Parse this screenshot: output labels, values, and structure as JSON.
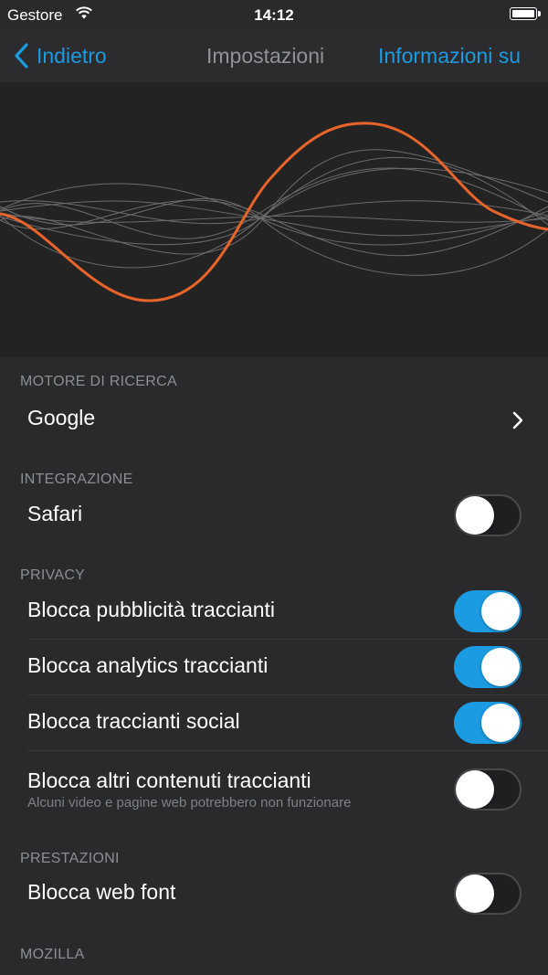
{
  "status_bar": {
    "carrier": "Gestore",
    "time": "14:12",
    "icons": [
      "wifi-icon",
      "battery-icon"
    ]
  },
  "nav": {
    "back_label": "Indietro",
    "title": "Impostazioni",
    "about_label": "Informazioni su",
    "accent_color": "#1a9be2"
  },
  "sections": {
    "search": {
      "header": "MOTORE DI RICERCA",
      "engine": "Google"
    },
    "integration": {
      "header": "INTEGRAZIONE",
      "safari": {
        "label": "Safari",
        "enabled": false
      }
    },
    "privacy": {
      "header": "PRIVACY",
      "items": [
        {
          "label": "Blocca pubblicità traccianti",
          "enabled": true
        },
        {
          "label": "Blocca analytics traccianti",
          "enabled": true
        },
        {
          "label": "Blocca traccianti social",
          "enabled": true
        },
        {
          "label": "Blocca altri contenuti traccianti",
          "sublabel": "Alcuni video e pagine web potrebbero non funzionare",
          "enabled": false
        }
      ]
    },
    "performance": {
      "header": "PRESTAZIONI",
      "web_fonts": {
        "label": "Blocca web font",
        "enabled": false
      }
    },
    "mozilla": {
      "header": "MOZILLA"
    }
  },
  "colors": {
    "background": "#2a2a2d",
    "wave_highlight": "#e8642a",
    "toggle_on": "#1a9be2"
  }
}
